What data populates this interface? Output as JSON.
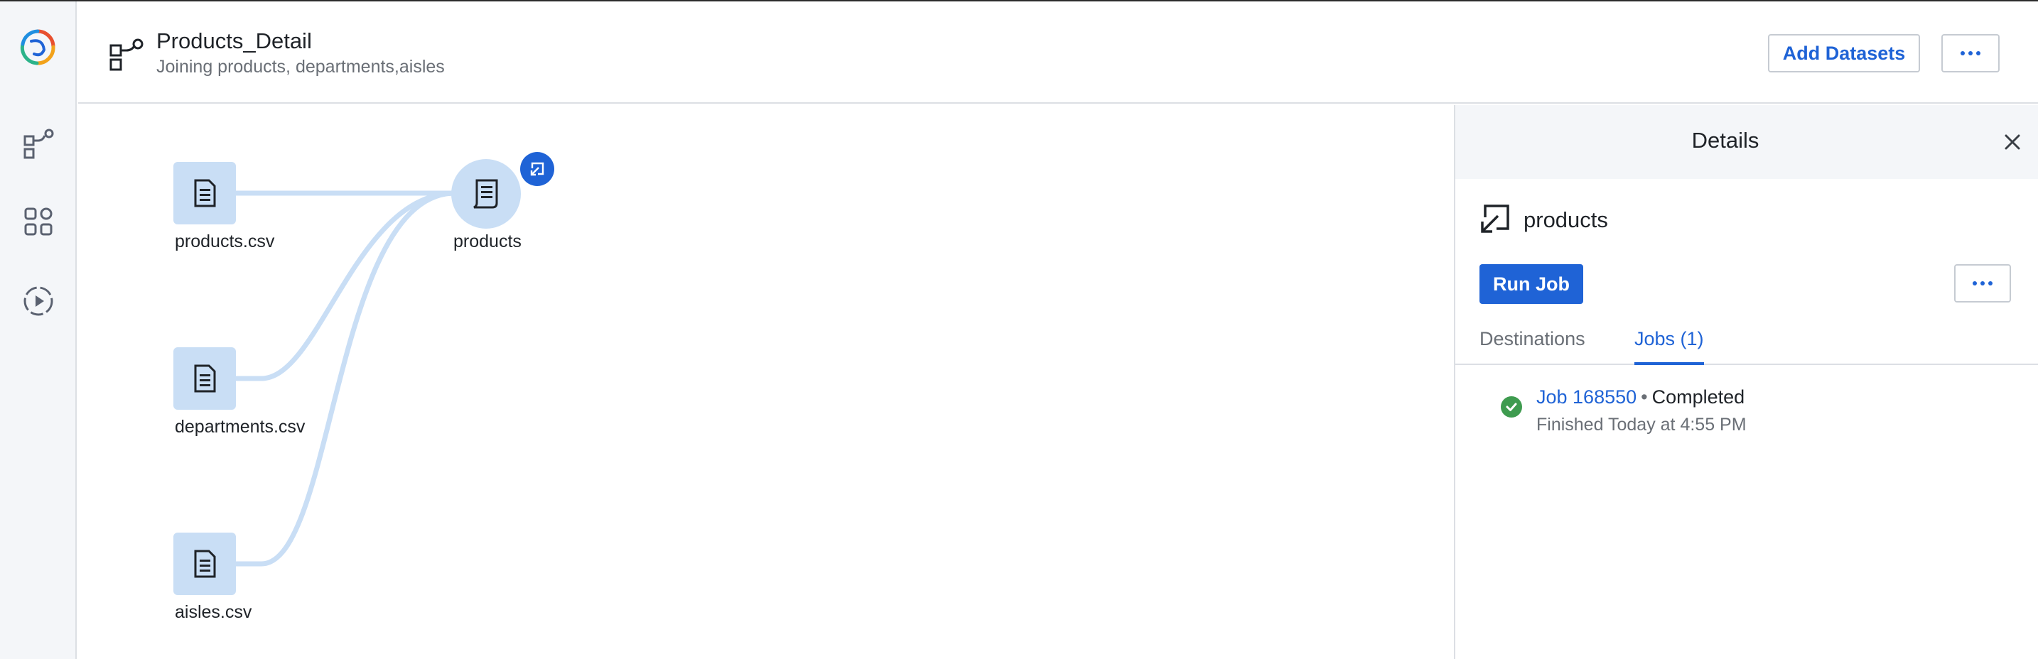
{
  "app": {
    "logo_icon": "swirl-logo-icon",
    "nav": [
      {
        "icon": "flow-icon",
        "name": "Flows"
      },
      {
        "icon": "grid-icon",
        "name": "Library"
      },
      {
        "icon": "play-circle-icon",
        "name": "Jobs"
      }
    ]
  },
  "header": {
    "title": "Products_Detail",
    "subtitle": "Joining products, departments,aisles",
    "add_datasets_label": "Add Datasets",
    "more_icon": "ellipsis-icon"
  },
  "canvas": {
    "sources": [
      {
        "label": "products.csv",
        "icon": "document-icon"
      },
      {
        "label": "departments.csv",
        "icon": "document-icon"
      },
      {
        "label": "aisles.csv",
        "icon": "document-icon"
      }
    ],
    "output": {
      "label": "products",
      "icon": "recipe-icon",
      "badge_icon": "output-arrow-icon"
    },
    "edge_color": "#c9def5"
  },
  "details": {
    "title": "Details",
    "dataset_name": "products",
    "run_job_label": "Run Job",
    "tabs": [
      {
        "label": "Destinations",
        "active": false
      },
      {
        "label": "Jobs (1)",
        "active": true
      }
    ],
    "jobs": [
      {
        "name": "Job 168550",
        "separator": "•",
        "status": "Completed",
        "finished": "Finished Today at 4:55 PM"
      }
    ]
  },
  "colors": {
    "accent": "#1f63d6",
    "success": "#3e9b4f",
    "node_fill": "#c9def5"
  }
}
